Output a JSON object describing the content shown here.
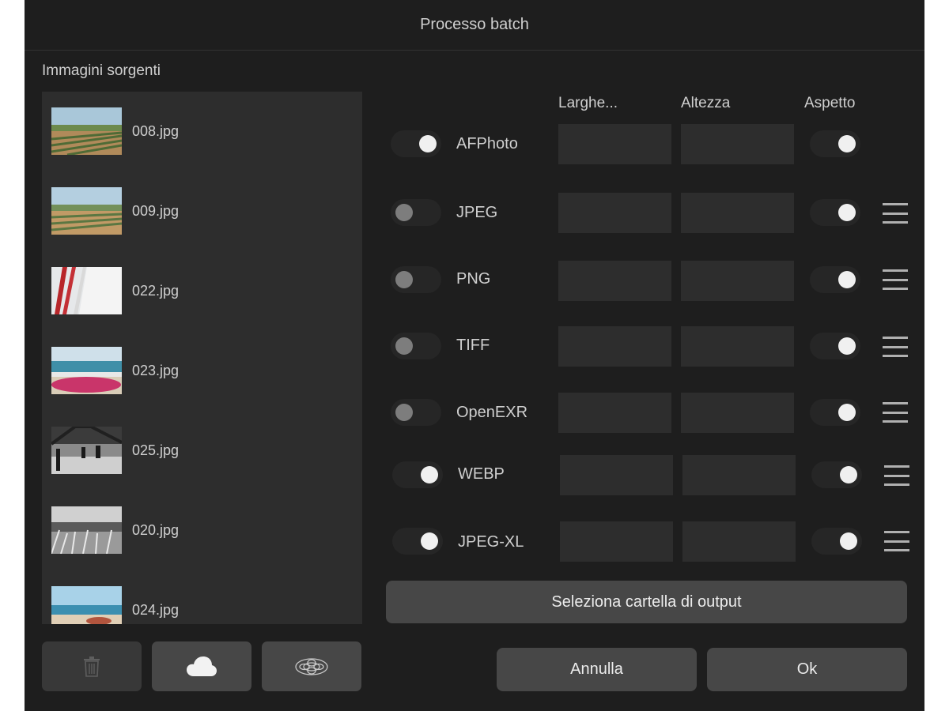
{
  "dialog": {
    "title": "Processo batch",
    "source_label": "Immagini sorgenti"
  },
  "images": [
    {
      "name": "008.jpg"
    },
    {
      "name": "009.jpg"
    },
    {
      "name": "022.jpg"
    },
    {
      "name": "023.jpg"
    },
    {
      "name": "025.jpg"
    },
    {
      "name": "020.jpg"
    },
    {
      "name": "024.jpg"
    }
  ],
  "bottom_buttons": [
    {
      "icon": "trash-icon",
      "enabled": false
    },
    {
      "icon": "cloud-icon",
      "enabled": true
    },
    {
      "icon": "photos-flower-icon",
      "enabled": true
    }
  ],
  "columns": {
    "width": "Larghe...",
    "height": "Altezza",
    "aspect": "Aspetto"
  },
  "formats": [
    {
      "label": "AFPhoto",
      "enabled": true,
      "width": "",
      "height": "",
      "aspect": true,
      "has_menu": false
    },
    {
      "label": "JPEG",
      "enabled": false,
      "width": "",
      "height": "",
      "aspect": true,
      "has_menu": true
    },
    {
      "label": "PNG",
      "enabled": false,
      "width": "",
      "height": "",
      "aspect": true,
      "has_menu": true
    },
    {
      "label": "TIFF",
      "enabled": false,
      "width": "",
      "height": "",
      "aspect": true,
      "has_menu": true
    },
    {
      "label": "OpenEXR",
      "enabled": false,
      "width": "",
      "height": "",
      "aspect": true,
      "has_menu": true
    },
    {
      "label": "WEBP",
      "enabled": true,
      "width": "",
      "height": "",
      "aspect": true,
      "has_menu": true
    },
    {
      "label": "JPEG-XL",
      "enabled": true,
      "width": "",
      "height": "",
      "aspect": true,
      "has_menu": true
    }
  ],
  "actions": {
    "select_output": "Seleziona cartella di output",
    "cancel": "Annulla",
    "ok": "Ok"
  },
  "colors": {
    "background": "#1e1e1e",
    "panel": "#2d2d2d",
    "button": "#474747",
    "text": "#cfcfcf"
  }
}
